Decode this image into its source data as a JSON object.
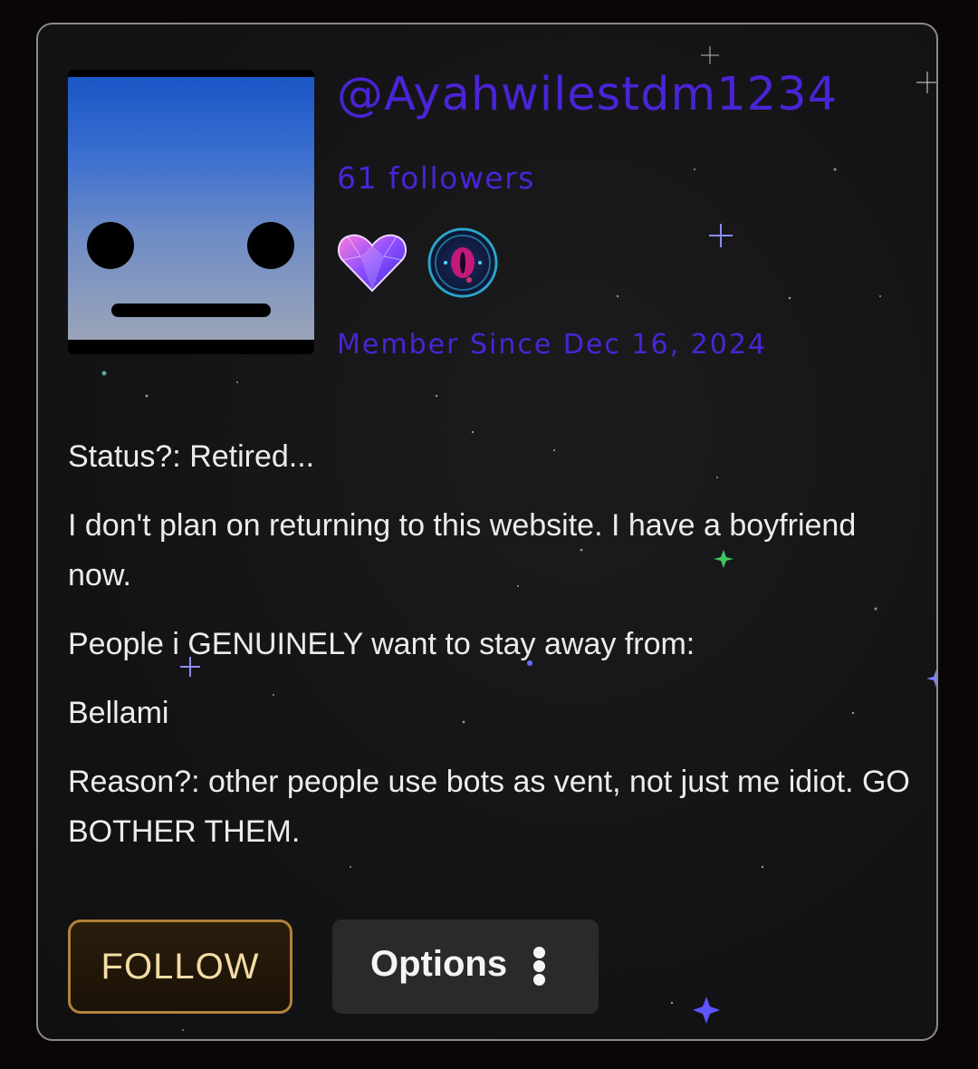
{
  "profile": {
    "username": "@Ayahwilestdm1234",
    "followers": "61 followers",
    "member_since": "Member Since Dec 16, 2024",
    "badges": [
      "heart-gem-badge-icon",
      "eye-orb-badge-icon"
    ]
  },
  "bio": {
    "lines": [
      "Status?: Retired...",
      "I don't plan on returning to this website. I have a boyfriend now.",
      "People i GENUINELY want to stay away from:",
      "Bellami",
      "Reason?: other people use bots as vent, not just me idiot. GO BOTHER THEM."
    ]
  },
  "actions": {
    "follow_label": "FOLLOW",
    "options_label": "Options"
  },
  "colors": {
    "accent": "#4a24d6",
    "follow_border": "#b0823a",
    "follow_text": "#f2dca4",
    "card_bg": "#141416"
  }
}
